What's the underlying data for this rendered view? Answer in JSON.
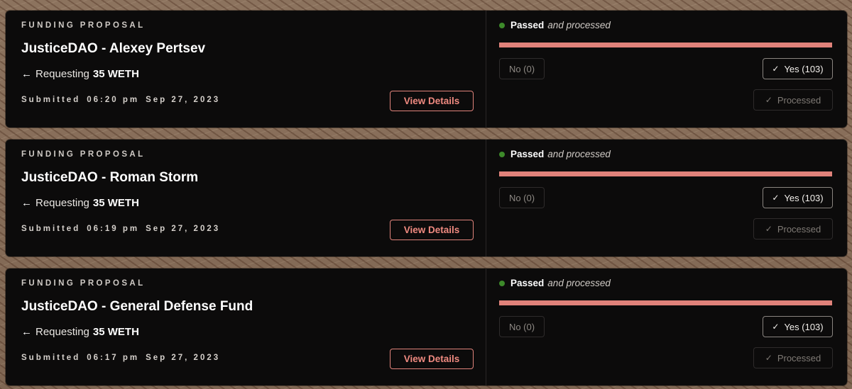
{
  "proposals": [
    {
      "type_label": "FUNDING PROPOSAL",
      "title": "JusticeDAO - Alexey Pertsev",
      "requesting_label": "Requesting",
      "requesting_amount": "35 WETH",
      "submitted_label": "Submitted",
      "submitted_time": "06:20 pm",
      "submitted_date": "Sep 27, 2023",
      "view_details_label": "View Details",
      "status": "Passed",
      "status_sub": "and processed",
      "yes_fraction": 1.0,
      "no_label": "No (0)",
      "yes_label": "Yes (103)",
      "processed_label": "Processed"
    },
    {
      "type_label": "FUNDING PROPOSAL",
      "title": "JusticeDAO - Roman Storm",
      "requesting_label": "Requesting",
      "requesting_amount": "35 WETH",
      "submitted_label": "Submitted",
      "submitted_time": "06:19 pm",
      "submitted_date": "Sep 27, 2023",
      "view_details_label": "View Details",
      "status": "Passed",
      "status_sub": "and processed",
      "yes_fraction": 1.0,
      "no_label": "No (0)",
      "yes_label": "Yes (103)",
      "processed_label": "Processed"
    },
    {
      "type_label": "FUNDING PROPOSAL",
      "title": "JusticeDAO - General Defense Fund",
      "requesting_label": "Requesting",
      "requesting_amount": "35 WETH",
      "submitted_label": "Submitted",
      "submitted_time": "06:17 pm",
      "submitted_date": "Sep 27, 2023",
      "view_details_label": "View Details",
      "status": "Passed",
      "status_sub": "and processed",
      "yes_fraction": 1.0,
      "no_label": "No (0)",
      "yes_label": "Yes (103)",
      "processed_label": "Processed"
    }
  ],
  "colors": {
    "card_bg": "#0c0b0b",
    "accent": "#e0827a",
    "status_green": "#3d8a2a",
    "page_bg": "#8a6f5a"
  },
  "icons": {
    "requesting": "arrow-left-icon",
    "vote": "check-icon",
    "status": "status-dot-icon"
  }
}
